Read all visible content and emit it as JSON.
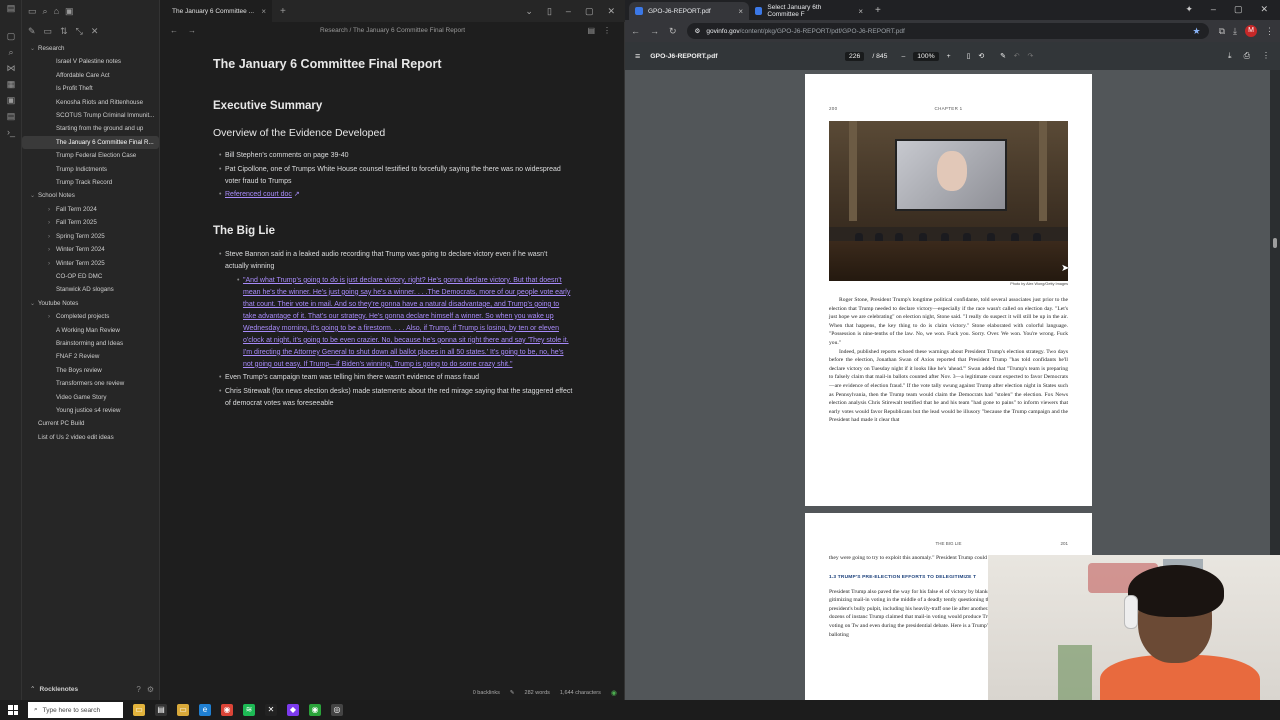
{
  "obsidian": {
    "tab_title": "The January 6 Committee ...",
    "breadcrumb": "Research / The January 6 Committee Final Report",
    "vault_name": "Rocklenotes",
    "status": {
      "backlinks": "0 backlinks",
      "words": "282 words",
      "characters": "1,644 characters"
    },
    "tree": [
      {
        "label": "Research",
        "level": 0,
        "caret": "v"
      },
      {
        "label": "Israel V Palestine notes",
        "level": 1
      },
      {
        "label": "Affordable Care Act",
        "level": 1
      },
      {
        "label": "Is Profit Theft",
        "level": 1
      },
      {
        "label": "Kenosha Riots and Rittenhouse",
        "level": 1
      },
      {
        "label": "SCOTUS Trump Criminal Immunit...",
        "level": 1
      },
      {
        "label": "Starting from the ground and up",
        "level": 1
      },
      {
        "label": "The January 6 Committee Final R...",
        "level": 1,
        "active": true
      },
      {
        "label": "Trump Federal Election Case",
        "level": 1
      },
      {
        "label": "Trump Indictments",
        "level": 1
      },
      {
        "label": "Trump Track Record",
        "level": 1
      },
      {
        "label": "School Notes",
        "level": 0,
        "caret": "v"
      },
      {
        "label": "Fall Term 2024",
        "level": 1,
        "caret": ">"
      },
      {
        "label": "Fall Term 2025",
        "level": 1,
        "caret": ">"
      },
      {
        "label": "Spring Term 2025",
        "level": 1,
        "caret": ">"
      },
      {
        "label": "Winter Term 2024",
        "level": 1,
        "caret": ">"
      },
      {
        "label": "Winter Term 2025",
        "level": 1,
        "caret": ">"
      },
      {
        "label": "CO-OP ED DMC",
        "level": 1
      },
      {
        "label": "Stanwick AD slogans",
        "level": 1
      },
      {
        "label": "Youtube Notes",
        "level": 0,
        "caret": "v"
      },
      {
        "label": "Completed projects",
        "level": 1,
        "caret": ">"
      },
      {
        "label": "A Working Man Review",
        "level": 1
      },
      {
        "label": "Brainstorming and Ideas",
        "level": 1
      },
      {
        "label": "FNAF 2 Review",
        "level": 1
      },
      {
        "label": "The Boys review",
        "level": 1
      },
      {
        "label": "Transformers one review",
        "level": 1
      },
      {
        "label": "Video Game Story",
        "level": 1
      },
      {
        "label": "Young justice s4 review",
        "level": 1
      },
      {
        "label": "Current PC Build",
        "level": 0
      },
      {
        "label": "List of Us 2 video edit ideas",
        "level": 0
      }
    ],
    "doc": {
      "title": "The January 6 Committee Final Report",
      "h_exec": "Executive Summary",
      "h_overview": "Overview of the Evidence Developed",
      "overview_items": [
        "Bill Stephen's comments on page 39-40",
        "Pat Cipollone, one of Trumps White House counsel testified to forcefully saying the there was no widespread voter fraud to Trumps"
      ],
      "court_doc_link": "Referenced court doc",
      "h_biglie": "The Big Lie",
      "biglie_item1": "Steve Bannon said in a leaked audio recording that Trump was going to declare victory even if he wasn't actually winning",
      "bannon_quote": "\"And what Trump's going to do is just declare victory, right? He's gonna declare victory. But that doesn't mean he's the winner. He's just going say he's a winner. . . .The Democrats, more of our people vote early that count. Their vote in mail. And so they're gonna have a natural disadvantage, and Trump's going to take advantage of it. That's our strategy. He's gonna declare himself a winner. So when you wake up Wednesday morning, it's going to be a firestorm. . . . Also, if Trump, if Trump is losing, by ten or eleven o'clock at night, it's going to be even crazier. No, because he's gonna sit right there and say 'They stole it. I'm directing the Attorney General to shut down all ballot places in all 50 states.' It's going to be, no, he's not going out easy. If Trump—if Biden's winning, Trump is going to do some crazy shit.\"",
      "biglie_item2": "Even Trump's campaign team was telling him there wasn't evidence of mass fraud",
      "biglie_item3": "Chris Stirewalt (fox news election desks) made statements about the red mirage saying that the staggered effect of democrat votes was foreseeable"
    }
  },
  "chrome": {
    "tabs": [
      {
        "label": "GPO-J6-REPORT.pdf",
        "active": true
      },
      {
        "label": "Select January 6th Committee F",
        "active": false
      }
    ],
    "url_host": "govinfo.gov",
    "url_path": "/content/pkg/GPO-J6-REPORT/pdf/GPO-J6-REPORT.pdf",
    "profile_initial": "M",
    "pdf": {
      "filename": "GPO-J6-REPORT.pdf",
      "page_current": "226",
      "page_total": "/ 845",
      "zoom": "100%"
    },
    "page1": {
      "page_no": "200",
      "chapter": "CHAPTER 1",
      "photo_credit": "Photo by Alex Wong/Getty Images",
      "paragraph1": "Roger Stone, President Trump's longtime political confidante, told several associates just prior to the election that Trump needed to declare victory—especially if the race wasn't called on election day. \"Let's just hope we are celebrating\" on election night, Stone said. \"I really do suspect it will still be up in the air. When that happens, the key thing to do is claim victory.\" Stone elaborated with colorful language. \"Possession is nine-tenths of the law. No, we won. Fuck you. Sorry. Over. We won. You're wrong. Fuck you.\"",
      "paragraph2": "Indeed, published reports echoed these warnings about President Trump's election strategy. Two days before the election, Jonathan Swan of Axios reported that President Trump \"has told confidants he'll declare victory on Tuesday night if it looks like he's 'ahead.'\" Swan added that \"Trump's team is preparing to falsely claim that mail-in ballots counted after Nov. 3—a legitimate count expected to favor Democrats—are evidence of election fraud.\" If the vote tally swung against Trump after election night in States such as Pennsylvania, then the Trump team would claim the Democrats had \"stolen\" the election. Fox News election analysis Chris Stirewalt testified that he and his team \"had gone to pains\" to inform viewers that early votes would favor Republicans but the lead would be illusory \"because the Trump campaign and the President had made it clear that"
    },
    "page2": {
      "header": "THE BIG LIE",
      "page_no": "201",
      "lead": "they were going to try to exploit this anomaly.\" President Trump could exploit the Red Mirage as w",
      "section": "1.3 TRUMP'S PRE-ELECTION EFFORTS TO DELEGITIMIZE T",
      "body": "President Trump also paved the way for his false el of victory by blanketing voters with a blizzard of lie gitimizing mail-in voting in the middle of a deadly tently questioning the security of ballots. President president's bully pulpit, including his heavily-traff one lie after another. The Select Committee found dozens of instanc Trump claimed that mail-in voting would produce Trump repeatedly denounced mail-in voting on Tw and even during the presidential debate. Here is a Trump's attempts to delegitimize mail-in balloting"
    }
  },
  "taskbar": {
    "search_placeholder": "Type here to search"
  }
}
